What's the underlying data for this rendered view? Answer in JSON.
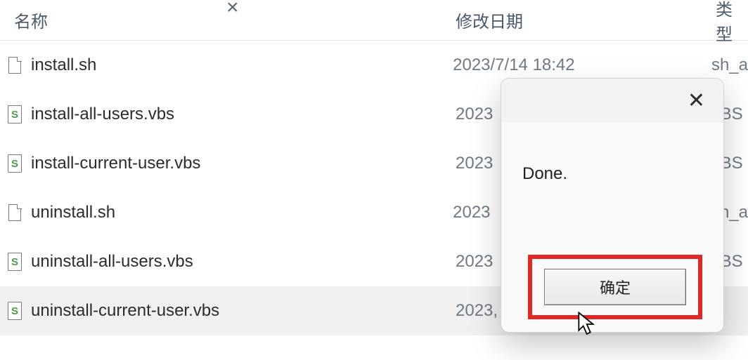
{
  "header": {
    "name": "名称",
    "date": "修改日期",
    "type": "类型"
  },
  "files": [
    {
      "name": "install.sh",
      "date": "2023/7/14 18:42",
      "type": "sh_a",
      "icon": "blank"
    },
    {
      "name": "install-all-users.vbs",
      "date": "2023",
      "type": "/BS",
      "icon": "vbs"
    },
    {
      "name": "install-current-user.vbs",
      "date": "2023",
      "type": "/BS",
      "icon": "vbs"
    },
    {
      "name": "uninstall.sh",
      "date": "2023",
      "type": "sh_a",
      "icon": "blank"
    },
    {
      "name": "uninstall-all-users.vbs",
      "date": "2023",
      "type": "/BS",
      "icon": "vbs"
    },
    {
      "name": "uninstall-current-user.vbs",
      "date": "2023,",
      "type": "",
      "icon": "vbs",
      "selected": true
    }
  ],
  "dialog": {
    "message": "Done.",
    "ok_label": "确定"
  }
}
